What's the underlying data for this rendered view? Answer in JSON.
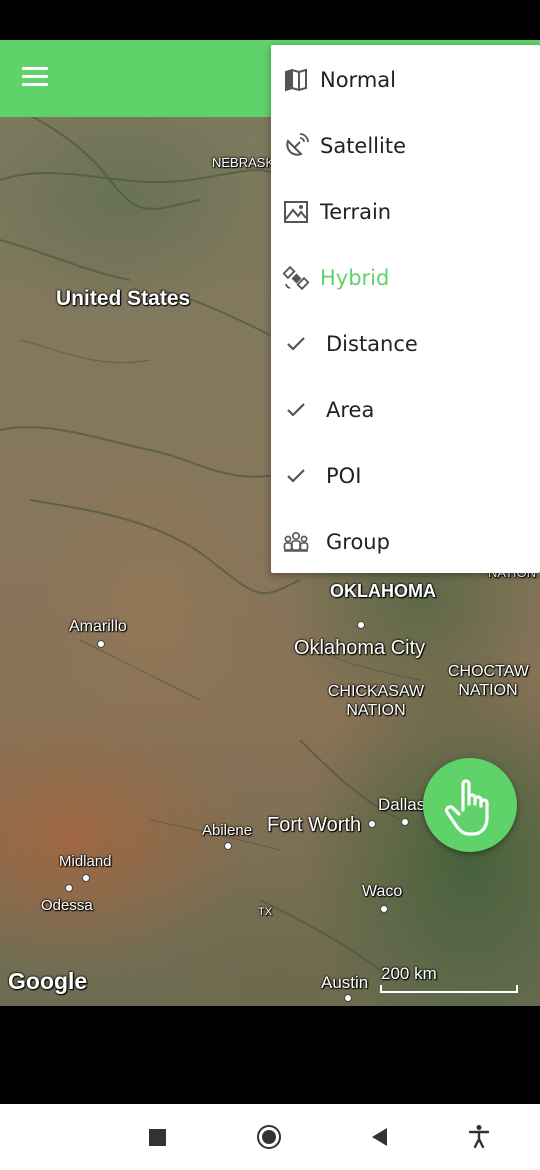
{
  "map": {
    "labels": {
      "nebraska": "NEBRASKA",
      "united_states": "United States",
      "oklahoma": "OKLAHOMA",
      "oklahoma_city": "Oklahoma City",
      "choctaw_nation": "CHOCTAW NATION",
      "chickasaw_nation": "CHICKASAW NATION",
      "amarillo": "Amarillo",
      "abilene": "Abilene",
      "fort_worth": "Fort Worth",
      "dallas": "Dallas",
      "midland": "Midland",
      "odessa": "Odessa",
      "waco": "Waco",
      "tx": "TX",
      "austin": "Austin",
      "nation_partial": "NATION"
    },
    "attribution": "Google",
    "scale_label": "200 km"
  },
  "menu": {
    "items": [
      {
        "label": "Normal",
        "icon": "map-icon",
        "active": false
      },
      {
        "label": "Satellite",
        "icon": "satellite-dish-icon",
        "active": false
      },
      {
        "label": "Terrain",
        "icon": "terrain-icon",
        "active": false
      },
      {
        "label": "Hybrid",
        "icon": "satellite-icon",
        "active": true
      },
      {
        "label": "Distance",
        "icon": "check-icon",
        "active": false
      },
      {
        "label": "Area",
        "icon": "check-icon",
        "active": false
      },
      {
        "label": "POI",
        "icon": "check-icon",
        "active": false
      },
      {
        "label": "Group",
        "icon": "group-icon",
        "active": false
      }
    ]
  },
  "colors": {
    "accent": "#5fd36a",
    "menu_text": "#222222",
    "menu_icon": "#555555"
  },
  "fab": {
    "icon": "hand-pointer-icon"
  },
  "system_nav": {
    "recents_icon": "square-icon",
    "home_icon": "circle-icon",
    "back_icon": "triangle-back-icon",
    "accessibility_icon": "accessibility-icon"
  }
}
